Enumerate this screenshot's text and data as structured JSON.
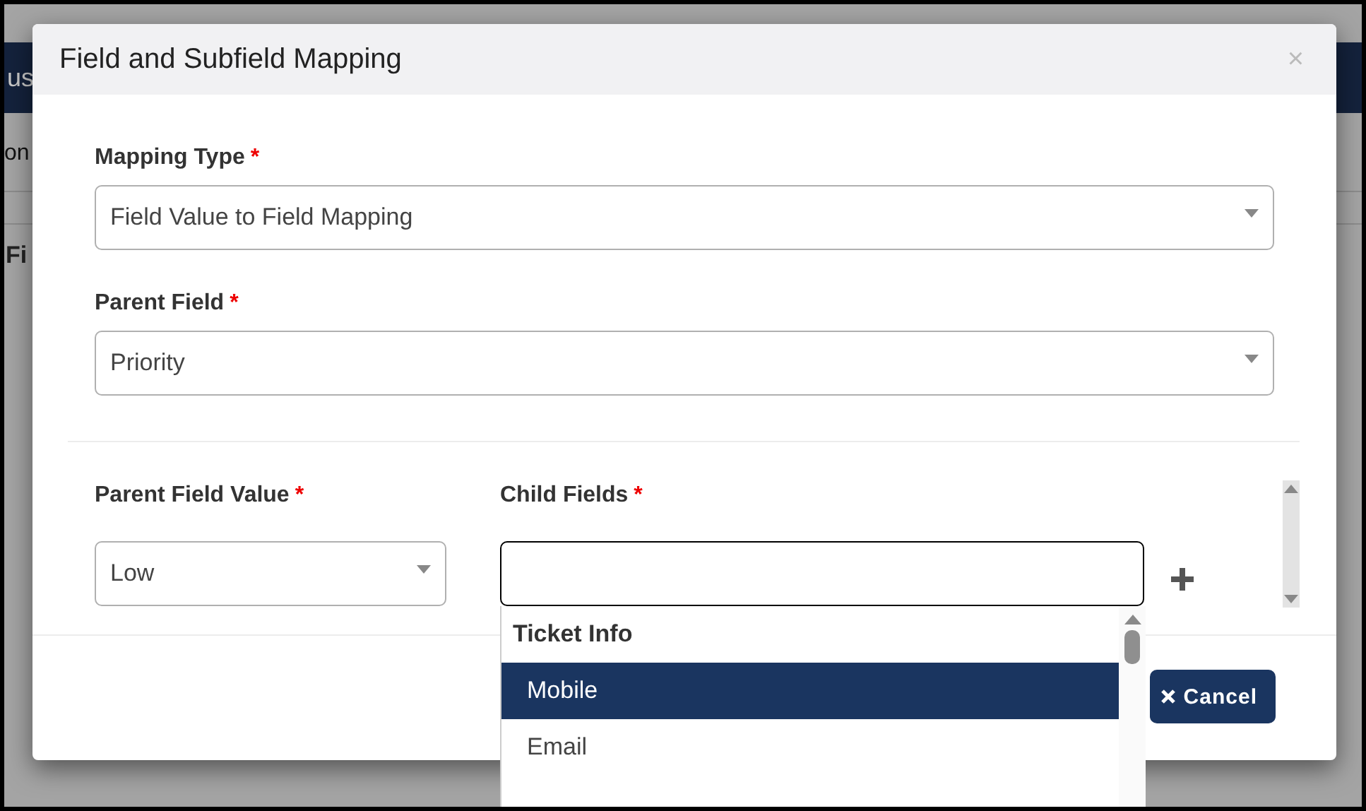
{
  "background_page": {
    "header_text": "us",
    "row_text": "on",
    "section_text": "Fi"
  },
  "dialog": {
    "title": "Field and Subfield Mapping",
    "close": "×",
    "mapping_type": {
      "label": "Mapping Type",
      "required_mark": "*",
      "value": "Field Value to Field Mapping"
    },
    "parent_field": {
      "label": "Parent Field",
      "required_mark": "*",
      "value": "Priority"
    },
    "parent_field_value": {
      "label": "Parent Field Value",
      "required_mark": "*",
      "value": "Low"
    },
    "child_fields": {
      "label": "Child Fields",
      "required_mark": "*",
      "focused": true,
      "dropdown": {
        "group_label": "Ticket Info",
        "options": [
          {
            "label": "Mobile",
            "selected": true
          },
          {
            "label": "Email",
            "selected": false
          }
        ]
      }
    },
    "cancel_button": "Cancel"
  }
}
